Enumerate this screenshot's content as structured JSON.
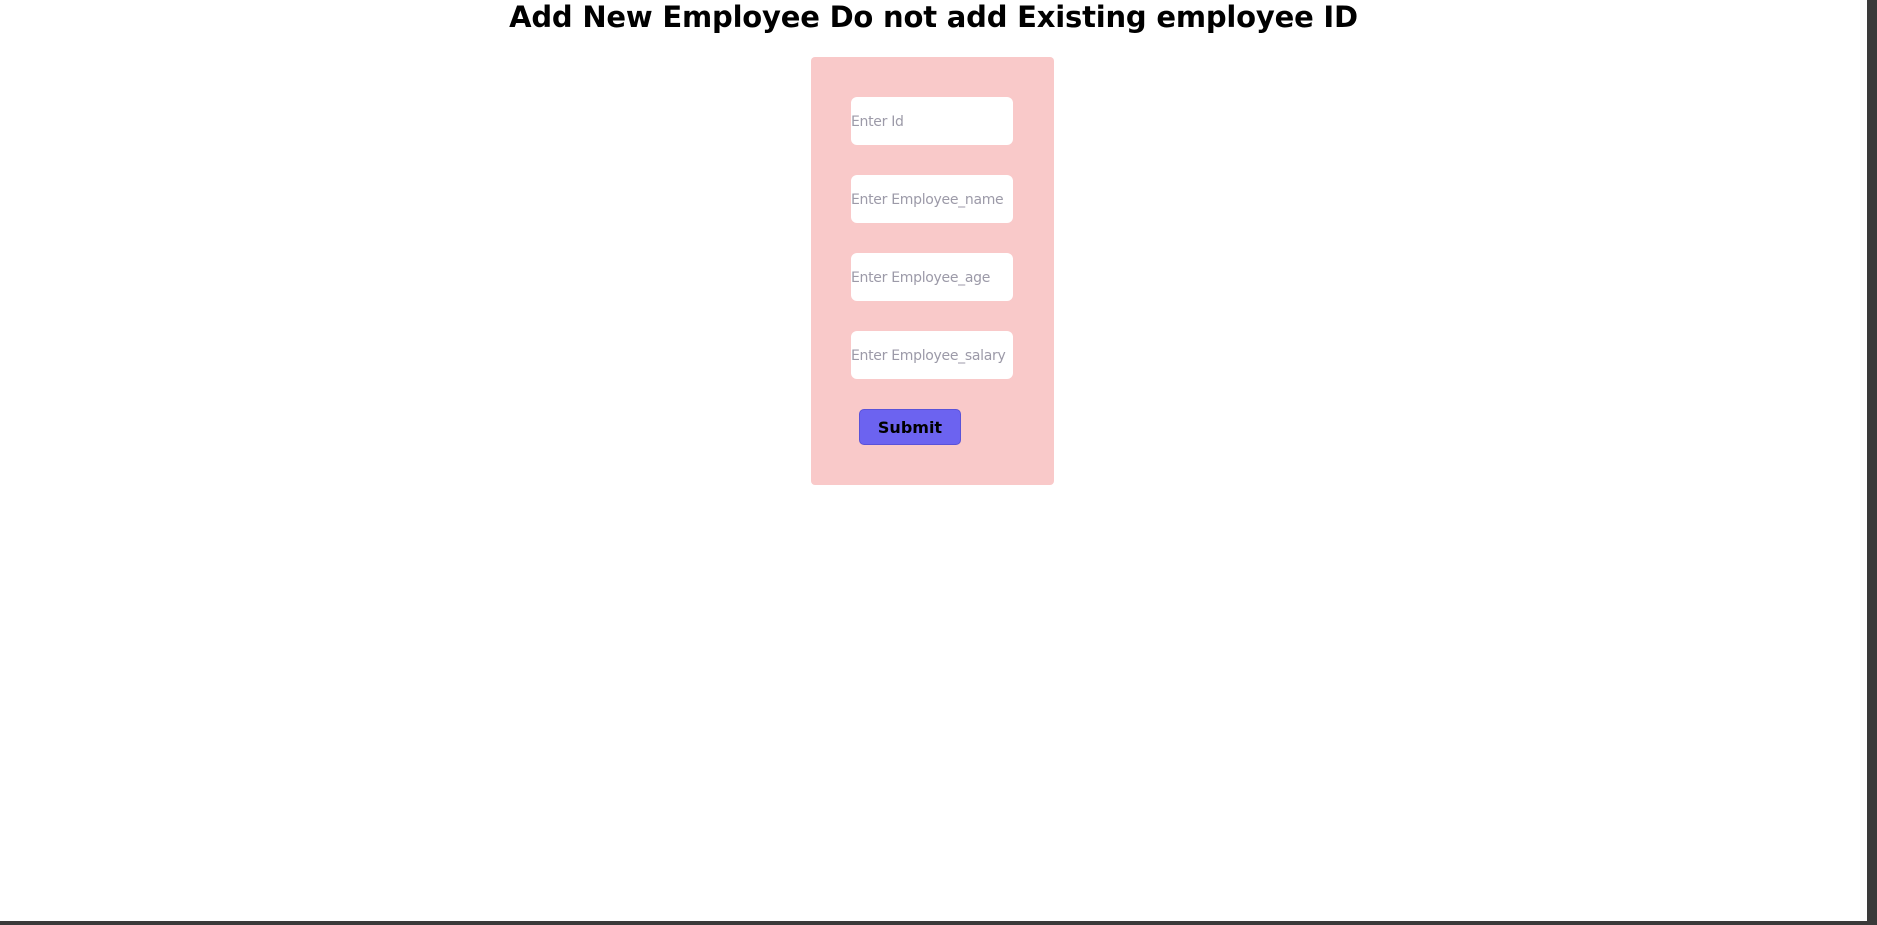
{
  "page": {
    "title": "Add New Employee Do not add Existing employee ID"
  },
  "form": {
    "fields": [
      {
        "placeholder": "Enter Id",
        "value": ""
      },
      {
        "placeholder": "Enter Employee_name",
        "value": ""
      },
      {
        "placeholder": "Enter Employee_age",
        "value": ""
      },
      {
        "placeholder": "Enter Employee_salary",
        "value": ""
      }
    ],
    "submit_label": "Submit"
  },
  "colors": {
    "card_background": "#f9c9c9",
    "button_background": "#6c63f0",
    "page_background": "#ffffff"
  }
}
